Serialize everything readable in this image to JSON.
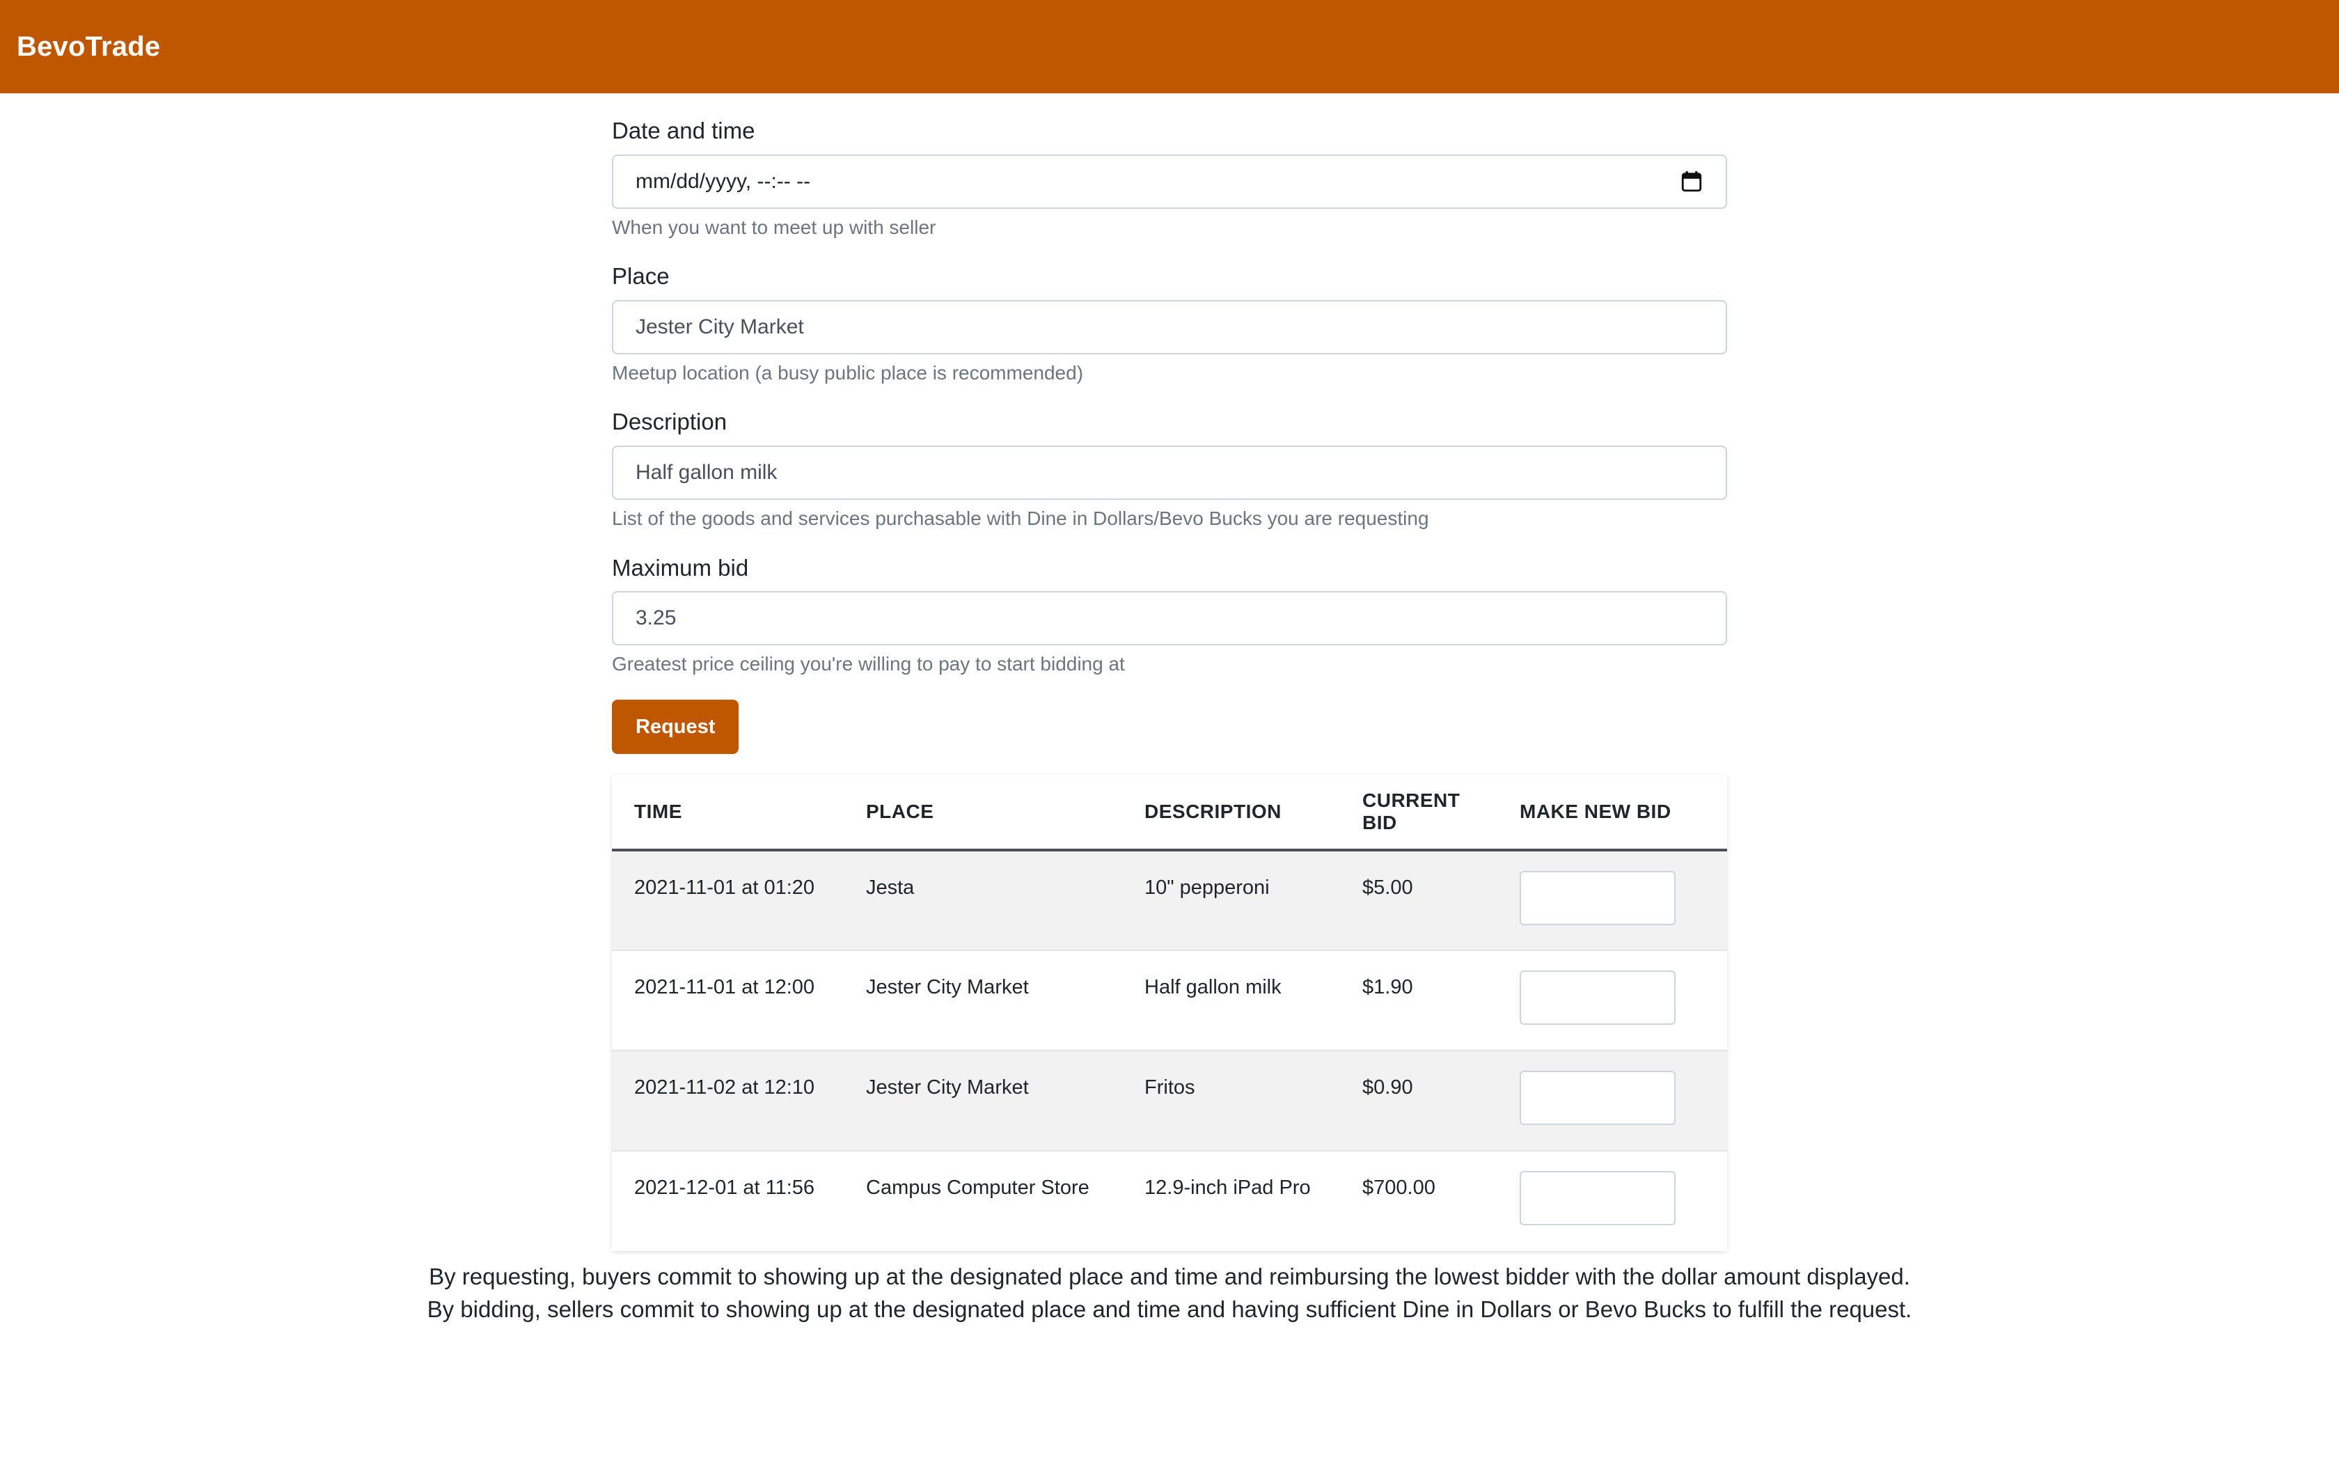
{
  "app": {
    "brand": "BevoTrade"
  },
  "form": {
    "datetime": {
      "label": "Date and time",
      "placeholder": "mm/dd/yyyy, --:-- --",
      "help": "When you want to meet up with seller"
    },
    "place": {
      "label": "Place",
      "value": "Jester City Market",
      "help": "Meetup location (a busy public place is recommended)"
    },
    "description": {
      "label": "Description",
      "value": "Half gallon milk",
      "help": "List of the goods and services purchasable with Dine in Dollars/Bevo Bucks you are requesting"
    },
    "max_bid": {
      "label": "Maximum bid",
      "value": "3.25",
      "help": "Greatest price ceiling you're willing to pay to start bidding at"
    },
    "submit_label": "Request"
  },
  "table": {
    "headers": [
      "TIME",
      "PLACE",
      "DESCRIPTION",
      "CURRENT BID",
      "MAKE NEW BID"
    ],
    "rows": [
      {
        "time": "2021-11-01 at 01:20",
        "place": "Jesta",
        "description": "10\" pepperoni",
        "current_bid": "$5.00"
      },
      {
        "time": "2021-11-01 at 12:00",
        "place": "Jester City Market",
        "description": "Half gallon milk",
        "current_bid": "$1.90"
      },
      {
        "time": "2021-11-02 at 12:10",
        "place": "Jester City Market",
        "description": "Fritos",
        "current_bid": "$0.90"
      },
      {
        "time": "2021-12-01 at 11:56",
        "place": "Campus Computer Store",
        "description": "12.9-inch iPad Pro",
        "current_bid": "$700.00"
      }
    ]
  },
  "footer": {
    "line1": "By requesting, buyers commit to showing up at the designated place and time and reimbursing the lowest bidder with the dollar amount displayed.",
    "line2": "By bidding, sellers commit to showing up at the designated place and time and having sufficient Dine in Dollars or Bevo Bucks to fulfill the request."
  },
  "colors": {
    "brand": "#bf5700",
    "row_stripe": "#f2f2f2"
  },
  "icons": {
    "datetime_picker": "calendar-icon"
  }
}
